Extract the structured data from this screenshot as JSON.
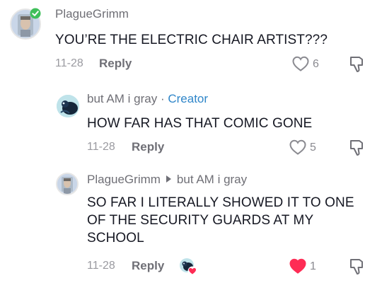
{
  "comments": [
    {
      "username": "PlagueGrimm",
      "text": "YOU’RE THE ELECTRIC CHAIR ARTIST???",
      "date": "11-28",
      "reply_label": "Reply",
      "likes": "6",
      "liked": false
    },
    {
      "username": "but AM i gray",
      "separator": "·",
      "badge": "Creator",
      "text": "HOW FAR HAS THAT COMIC GONE",
      "date": "11-28",
      "reply_label": "Reply",
      "likes": "5",
      "liked": false
    },
    {
      "username": "PlagueGrimm",
      "reply_to": "but AM i gray",
      "text_lines": [
        "SO FAR I LITERALLY SHOWED IT TO ONE",
        "OF THE SECURITY GUARDS AT MY",
        "SCHOOL"
      ],
      "date": "11-28",
      "reply_label": "Reply",
      "likes": "1",
      "liked": true
    }
  ],
  "colors": {
    "like_active": "#fe2c55",
    "creator_badge": "#2f86c9",
    "muted_text": "#6f6f76"
  },
  "icons": [
    "heart-icon",
    "dislike-icon",
    "verified-check-icon",
    "creator-liked-icon"
  ]
}
